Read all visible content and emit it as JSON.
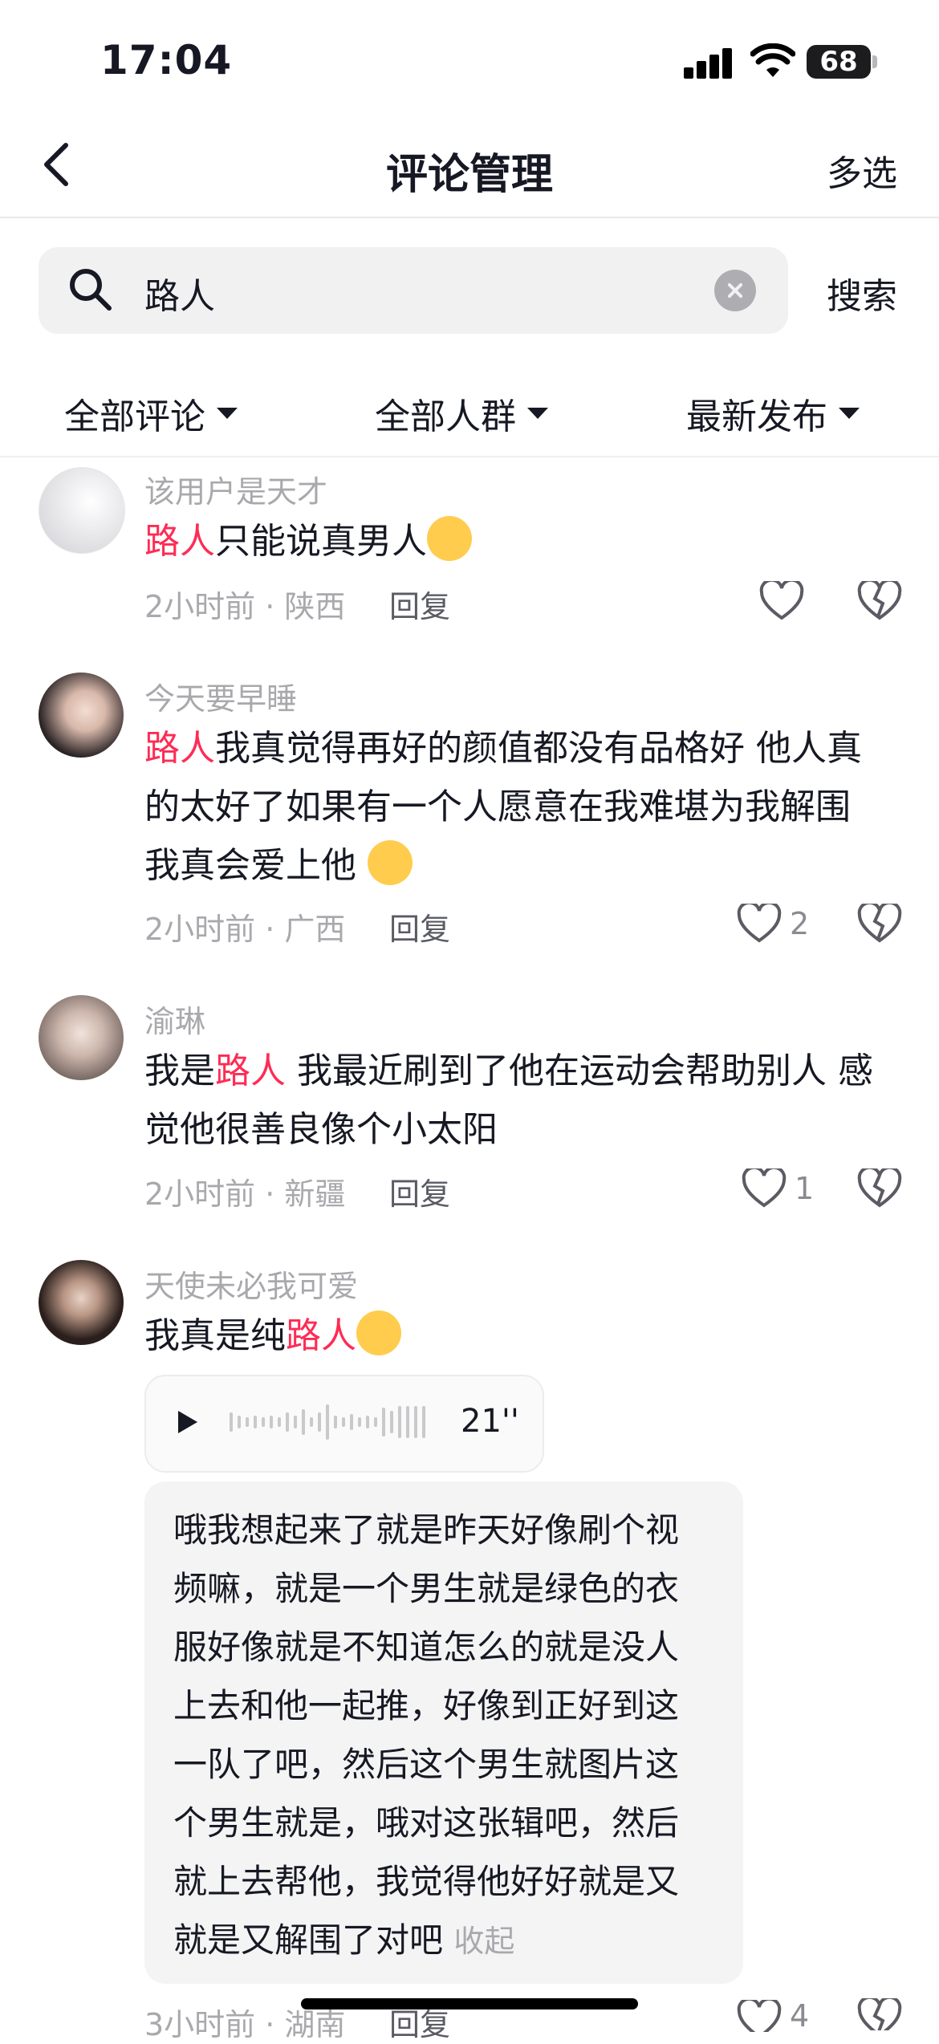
{
  "status": {
    "time": "17:04",
    "battery": "68"
  },
  "nav": {
    "title": "评论管理",
    "multi_select": "多选"
  },
  "search": {
    "query": "路人",
    "button": "搜索"
  },
  "filters": [
    {
      "label": "全部评论"
    },
    {
      "label": "全部人群"
    },
    {
      "label": "最新发布"
    }
  ],
  "comments": [
    {
      "username": "该用户是天才",
      "highlight": "路人",
      "text_after": "只能说真男人",
      "meta": "2小时前 · 陕西",
      "reply": "回复",
      "likes": ""
    },
    {
      "username": "今天要早睡",
      "highlight": "路人",
      "line1_rest": "我真觉得再好的颜值都没有品格好 他人真",
      "line2": "的太好了如果有一个人愿意在我难堪为我解围",
      "line3": "我真会爱上他",
      "meta": "2小时前 · 广西",
      "reply": "回复",
      "likes": "2"
    },
    {
      "username": "渝琳",
      "before": "我是",
      "highlight": "路人",
      "line1_rest": " 我最近刷到了他在运动会帮助别人 感",
      "line2": "觉他很善良像个小太阳",
      "meta": "2小时前 · 新疆",
      "reply": "回复",
      "likes": "1"
    },
    {
      "username": "天使未必我可爱",
      "before": "我真是纯",
      "highlight": "路人",
      "voice_duration": "21''",
      "transcript": [
        "哦我想起来了就是昨天好像刷个视",
        "频嘛，就是一个男生就是绿色的衣",
        "服好像就是不知道怎么的就是没人",
        "上去和他一起推，好像到正好到这",
        "一队了吧，然后这个男生就图片这",
        "个男生就是，哦对这张辑吧，然后",
        "就上去帮他，我觉得他好好就是又",
        "就是又解围了对吧"
      ],
      "collapse": "收起",
      "meta": "3小时前 · 湖南",
      "reply": "回复",
      "likes": "4"
    }
  ],
  "colors": {
    "highlight": "#fe2c55",
    "muted": "#a9a9ad",
    "text": "#161823"
  }
}
